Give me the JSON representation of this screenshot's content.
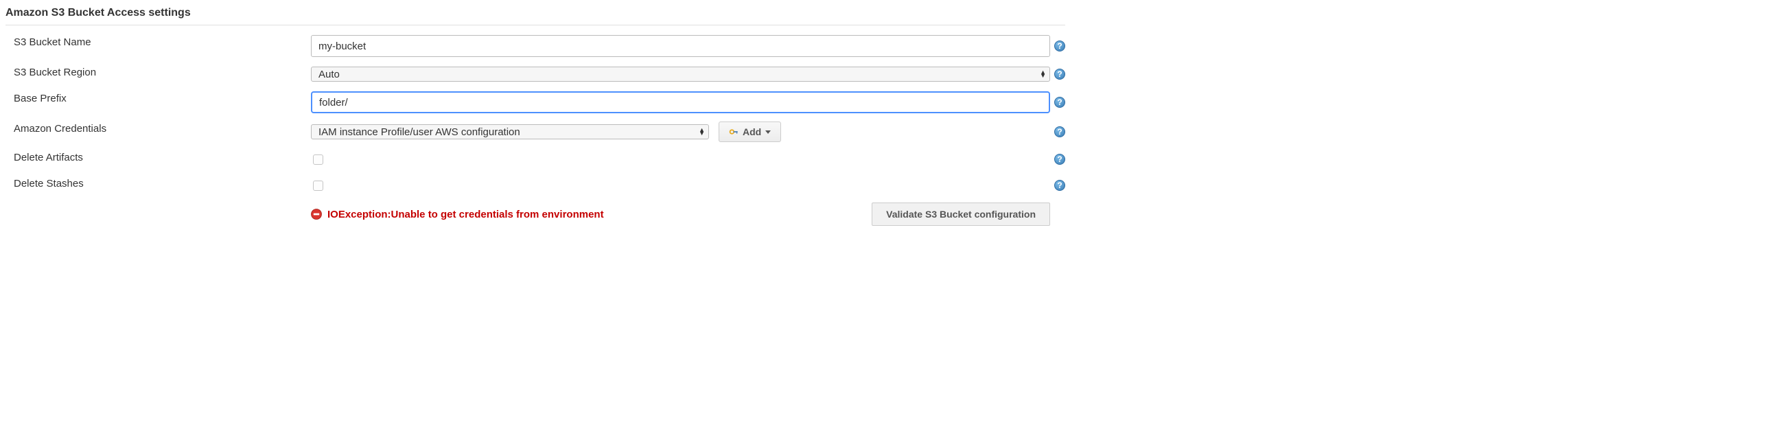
{
  "section": {
    "title": "Amazon S3 Bucket Access settings"
  },
  "fields": {
    "bucketName": {
      "label": "S3 Bucket Name",
      "value": "my-bucket"
    },
    "bucketRegion": {
      "label": "S3 Bucket Region",
      "value": "Auto"
    },
    "basePrefix": {
      "label": "Base Prefix",
      "value": "folder/"
    },
    "credentials": {
      "label": "Amazon Credentials",
      "value": "IAM instance Profile/user AWS configuration"
    },
    "deleteArtifacts": {
      "label": "Delete Artifacts"
    },
    "deleteStashes": {
      "label": "Delete Stashes"
    }
  },
  "buttons": {
    "add": "Add",
    "validate": "Validate S3 Bucket configuration"
  },
  "error": {
    "message": "IOException:Unable to get credentials from environment"
  },
  "colors": {
    "error": "#c40000",
    "focus": "#4d90fe"
  }
}
